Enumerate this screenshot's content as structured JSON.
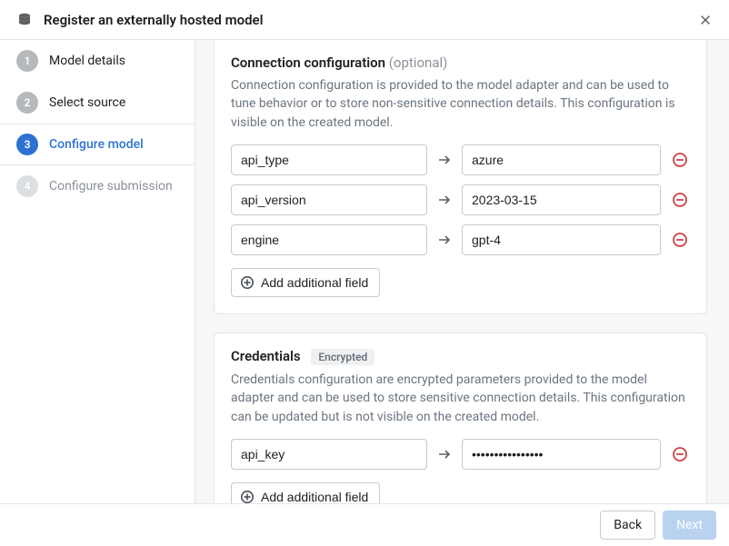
{
  "header": {
    "title": "Register an externally hosted model"
  },
  "sidebar": {
    "steps": [
      {
        "num": "1",
        "label": "Model details"
      },
      {
        "num": "2",
        "label": "Select source"
      },
      {
        "num": "3",
        "label": "Configure model"
      },
      {
        "num": "4",
        "label": "Configure submission"
      }
    ]
  },
  "connection": {
    "heading": "Connection configuration",
    "optional": "(optional)",
    "description": "Connection configuration is provided to the model adapter and can be used to tune behavior or to store non-sensitive connection details. This configuration is visible on the created model.",
    "rows": [
      {
        "key": "api_type",
        "value": "azure"
      },
      {
        "key": "api_version",
        "value": "2023-03-15"
      },
      {
        "key": "engine",
        "value": "gpt-4"
      }
    ],
    "add_label": "Add additional field"
  },
  "credentials": {
    "heading": "Credentials",
    "tag": "Encrypted",
    "description": "Credentials configuration are encrypted parameters provided to the model adapter and can be used to store sensitive connection details. This configuration can be updated but is not visible on the created model.",
    "rows": [
      {
        "key": "api_key",
        "value": "••••••••••••••••"
      }
    ],
    "add_label": "Add additional field"
  },
  "footer": {
    "back": "Back",
    "next": "Next"
  }
}
